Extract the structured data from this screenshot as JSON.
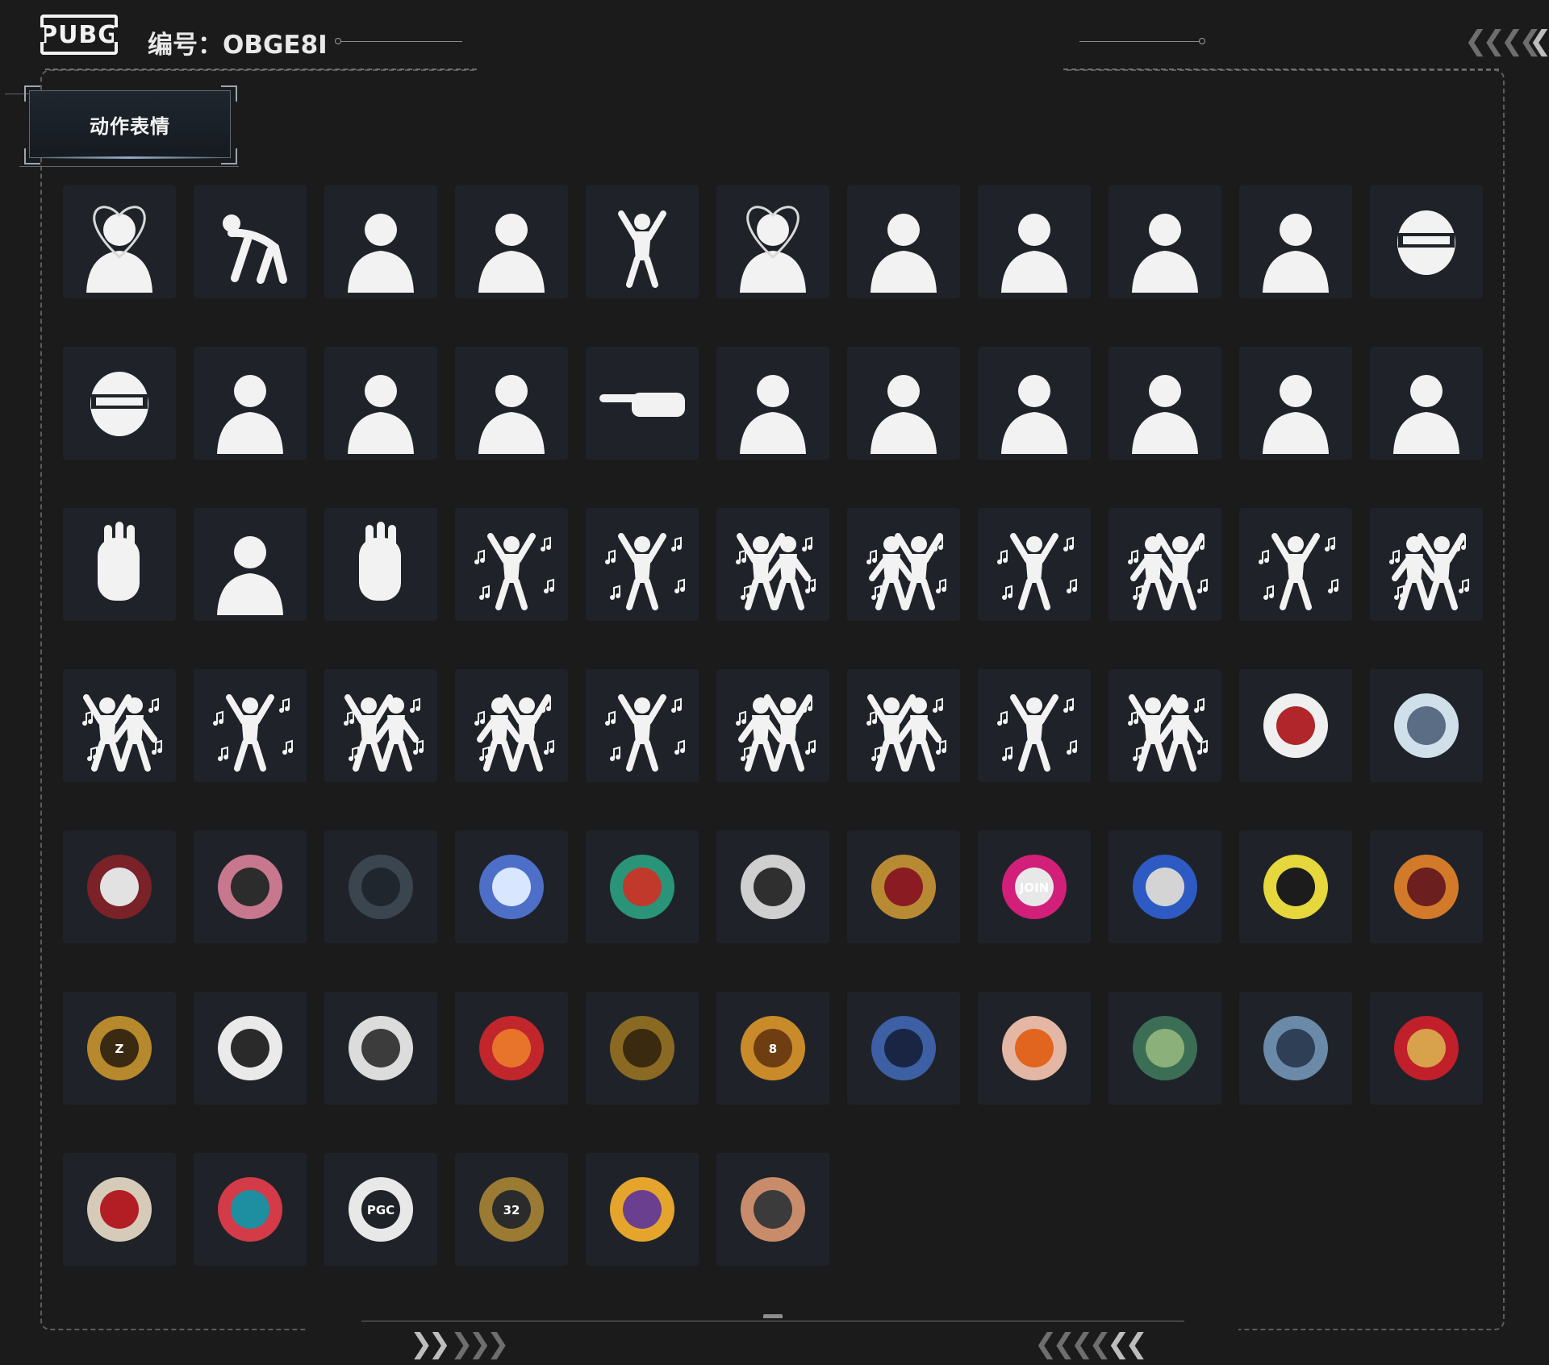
{
  "header": {
    "logo_text": "PUBG",
    "account_id": "编号：OBGE8I"
  },
  "section": {
    "tab_label": "动作表情"
  },
  "items": [
    {
      "icon": "heart-hands-emote-icon"
    },
    {
      "icon": "crawl-emote-icon"
    },
    {
      "icon": "thinking-emote-icon"
    },
    {
      "icon": "cover-eyes-emote-icon"
    },
    {
      "icon": "cheer-emote-icon"
    },
    {
      "icon": "heart-gesture-emote-icon"
    },
    {
      "icon": "hands-up-emote-icon"
    },
    {
      "icon": "wave-emote-icon"
    },
    {
      "icon": "shake-head-emote-icon"
    },
    {
      "icon": "bow-emote-icon"
    },
    {
      "icon": "helmet-angry-emote-icon"
    },
    {
      "icon": "helmet-laugh-emote-icon"
    },
    {
      "icon": "clap-emote-icon"
    },
    {
      "icon": "nose-pick-emote-icon"
    },
    {
      "icon": "dizzy-emote-icon"
    },
    {
      "icon": "point-emote-icon"
    },
    {
      "icon": "come-here-emote-icon"
    },
    {
      "icon": "shrug-emote-icon"
    },
    {
      "icon": "sigh-emote-icon"
    },
    {
      "icon": "flex-emote-icon"
    },
    {
      "icon": "facepalm-cry-emote-icon"
    },
    {
      "icon": "facepalm-emote-icon"
    },
    {
      "icon": "stop-hand-emote-icon"
    },
    {
      "icon": "arms-crossed-emote-icon"
    },
    {
      "icon": "thumbs-up-emote-icon"
    },
    {
      "icon": "dance-point-emote-icon"
    },
    {
      "icon": "dance-pose-emote-icon"
    },
    {
      "icon": "dance-duo-kick-emote-icon"
    },
    {
      "icon": "dance-duo-emote-icon"
    },
    {
      "icon": "dance-step-emote-icon"
    },
    {
      "icon": "dance-duo-point-emote-icon"
    },
    {
      "icon": "dance-flower-emote-icon"
    },
    {
      "icon": "dance-duo-arms-emote-icon"
    },
    {
      "icon": "dance-duo-stand-emote-icon"
    },
    {
      "icon": "breakdance-emote-icon"
    },
    {
      "icon": "dance-duo-sway-emote-icon"
    },
    {
      "icon": "dance-duo-spread-emote-icon"
    },
    {
      "icon": "dance-wave-emote-icon"
    },
    {
      "icon": "dance-duo-run-emote-icon"
    },
    {
      "icon": "dance-duo-lean-emote-icon"
    },
    {
      "icon": "headspin-emote-icon"
    },
    {
      "icon": "dance-duo-march-emote-icon"
    },
    {
      "icon": "lucky-eight-sticker-icon"
    },
    {
      "icon": "spray-can-sticker-icon"
    },
    {
      "icon": "fried-egg-sticker-icon"
    },
    {
      "icon": "green-cat-sticker-icon"
    },
    {
      "icon": "frog-knight-sticker-icon"
    },
    {
      "icon": "red-diamond-sticker-icon"
    },
    {
      "icon": "rooster-sticker-icon"
    },
    {
      "icon": "graffiti-sticker-icon"
    },
    {
      "icon": "pgc-sticker-icon"
    },
    {
      "icon": "badge-32-sticker-icon"
    },
    {
      "icon": "yellow-blob-sticker-icon"
    },
    {
      "icon": "finger-heart-sticker-icon"
    },
    {
      "icon": "lucky-cards-sticker-icon"
    },
    {
      "icon": "snowman-sticker-icon"
    },
    {
      "icon": "wolf-skull-sticker-icon"
    },
    {
      "icon": "cry-baby-heart-sticker-icon"
    },
    {
      "icon": "rat-sticker-icon"
    },
    {
      "icon": "moon-cloud-sticker-icon"
    },
    {
      "icon": "dragon-sticker-icon"
    },
    {
      "icon": "poster-sticker-icon"
    },
    {
      "icon": "rose-crest-sticker-icon"
    },
    {
      "icon": "join-us-sticker-icon"
    },
    {
      "icon": "lighter-sticker-icon"
    },
    {
      "icon": "lemon-sunglasses-sticker-icon"
    },
    {
      "icon": "winner-chicken-sticker-icon"
    },
    {
      "icon": "letter-z-sticker-icon"
    },
    {
      "icon": "ghost-sticker-icon"
    },
    {
      "icon": "journey-sticker-icon"
    },
    {
      "icon": "red-shield-sticker-icon"
    },
    {
      "icon": "gold-orb-sticker-icon"
    }
  ]
}
